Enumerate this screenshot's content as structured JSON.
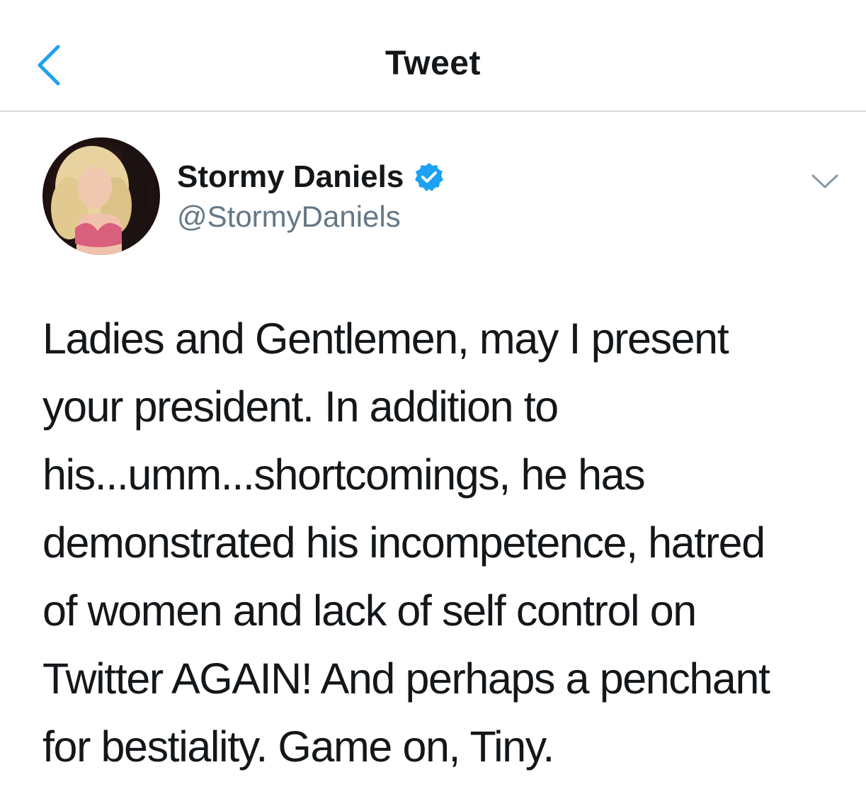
{
  "header": {
    "title": "Tweet",
    "back_icon": "chevron-left-icon",
    "accent_color": "#1da1f2"
  },
  "author": {
    "display_name": "Stormy Daniels",
    "handle": "@StormyDaniels",
    "verified": true,
    "verified_icon": "verified-badge-icon",
    "more_icon": "chevron-down-icon"
  },
  "tweet": {
    "lines": [
      "Ladies and Gentlemen,  may I present",
      "your president. In addition to",
      "his...umm...shortcomings, he has",
      "demonstrated his incompetence, hatred",
      "of women and lack of self control on",
      "Twitter AGAIN! And perhaps a penchant",
      "for bestiality. Game on, Tiny."
    ]
  }
}
